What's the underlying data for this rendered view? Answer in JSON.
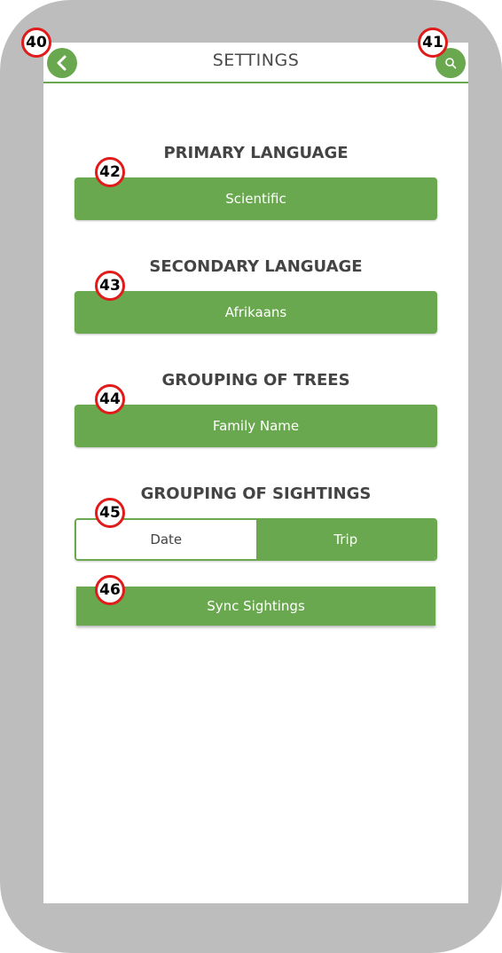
{
  "header": {
    "title": "SETTINGS",
    "back_icon": "chevron-left-icon",
    "search_icon": "search-icon"
  },
  "sections": {
    "primary_language": {
      "title": "PRIMARY LANGUAGE",
      "value": "Scientific"
    },
    "secondary_language": {
      "title": "SECONDARY LANGUAGE",
      "value": "Afrikaans"
    },
    "grouping_trees": {
      "title": "GROUPING OF TREES",
      "value": "Family Name"
    },
    "grouping_sightings": {
      "title": "GROUPING OF SIGHTINGS",
      "options": [
        "Date",
        "Trip"
      ],
      "selected": "Trip"
    }
  },
  "sync": {
    "label": "Sync Sightings"
  },
  "markers": [
    "40",
    "41",
    "42",
    "43",
    "44",
    "45",
    "46"
  ],
  "colors": {
    "accent": "#6aa84f",
    "frame": "#bdbdbd",
    "marker_ring": "#e01b1b",
    "text": "#444444"
  }
}
